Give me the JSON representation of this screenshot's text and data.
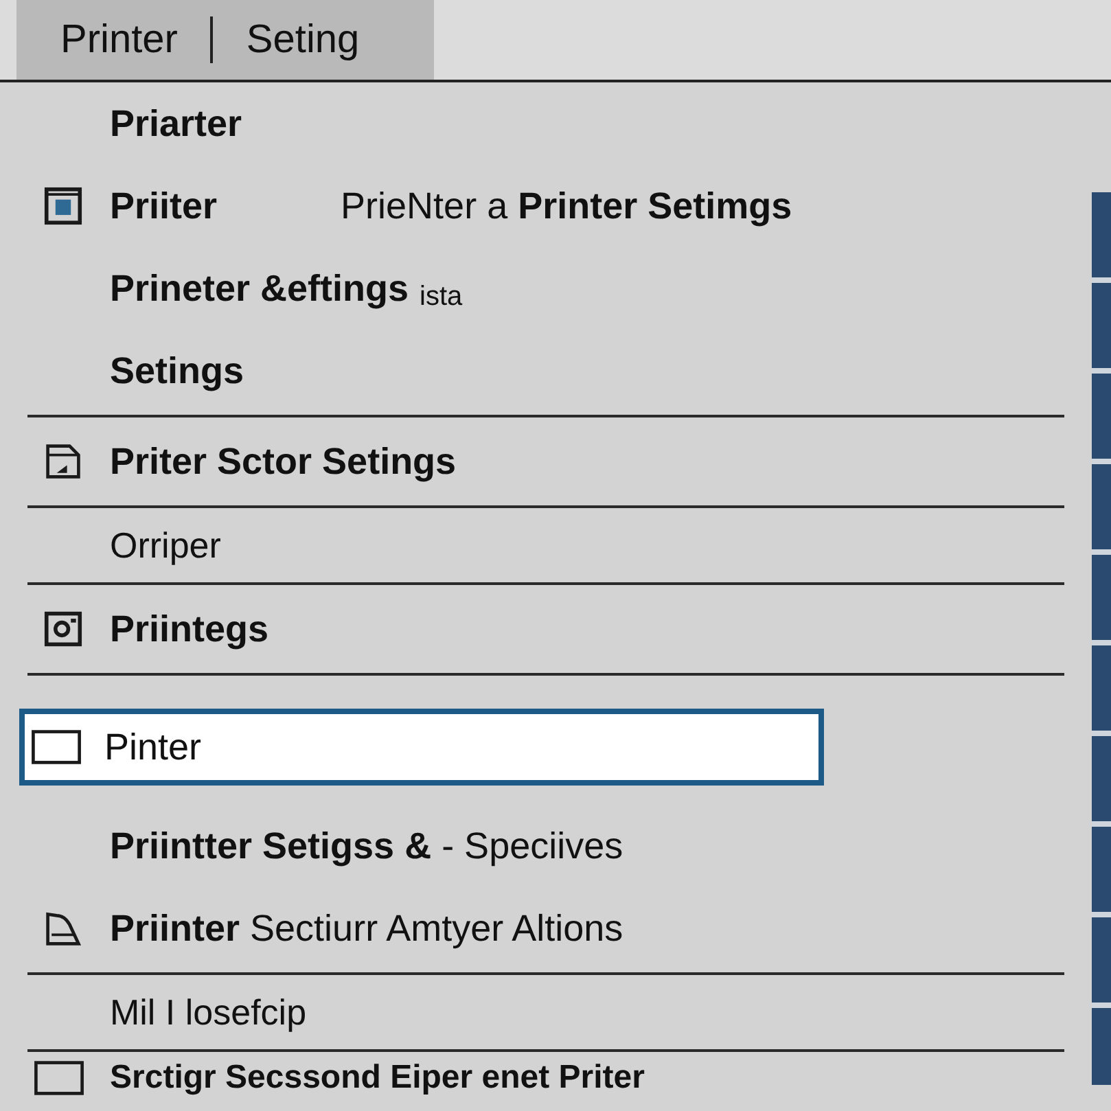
{
  "tab_bar": {
    "labels": [
      "Printer",
      "Seting"
    ]
  },
  "menu": [
    {
      "kind": "item",
      "text": "Priarter",
      "selected": false
    },
    {
      "kind": "item",
      "text": "Priiter",
      "secondary": "PrieNter a **Printer Setimgs**",
      "selected": false
    },
    {
      "kind": "item",
      "text": "Prineter &eftings",
      "note": "ista",
      "selected": false
    },
    {
      "kind": "item",
      "text": "Setings",
      "selected": false
    },
    {
      "kind": "divider"
    },
    {
      "kind": "item",
      "text": "Priter Sctor Setings",
      "selected": false
    },
    {
      "kind": "divider"
    },
    {
      "kind": "minor",
      "text": "Orriper",
      "selected": false
    },
    {
      "kind": "divider"
    },
    {
      "kind": "item",
      "text": "Priintegs",
      "selected": false
    },
    {
      "kind": "divider"
    },
    {
      "kind": "item",
      "text": "Pinter",
      "selected": true
    },
    {
      "kind": "item",
      "text": "**Priintter Setigss &** - Speciives",
      "selected": false
    },
    {
      "kind": "item",
      "text": "**Priinter** Sectiurr Amtyer Altions",
      "selected": false
    },
    {
      "kind": "divider"
    },
    {
      "kind": "minor",
      "text": "Mil I losefcip",
      "selected": false
    },
    {
      "kind": "divider"
    },
    {
      "kind": "item",
      "text": "Srctigr Secssond Eiper enet Priter",
      "selected": false
    }
  ]
}
